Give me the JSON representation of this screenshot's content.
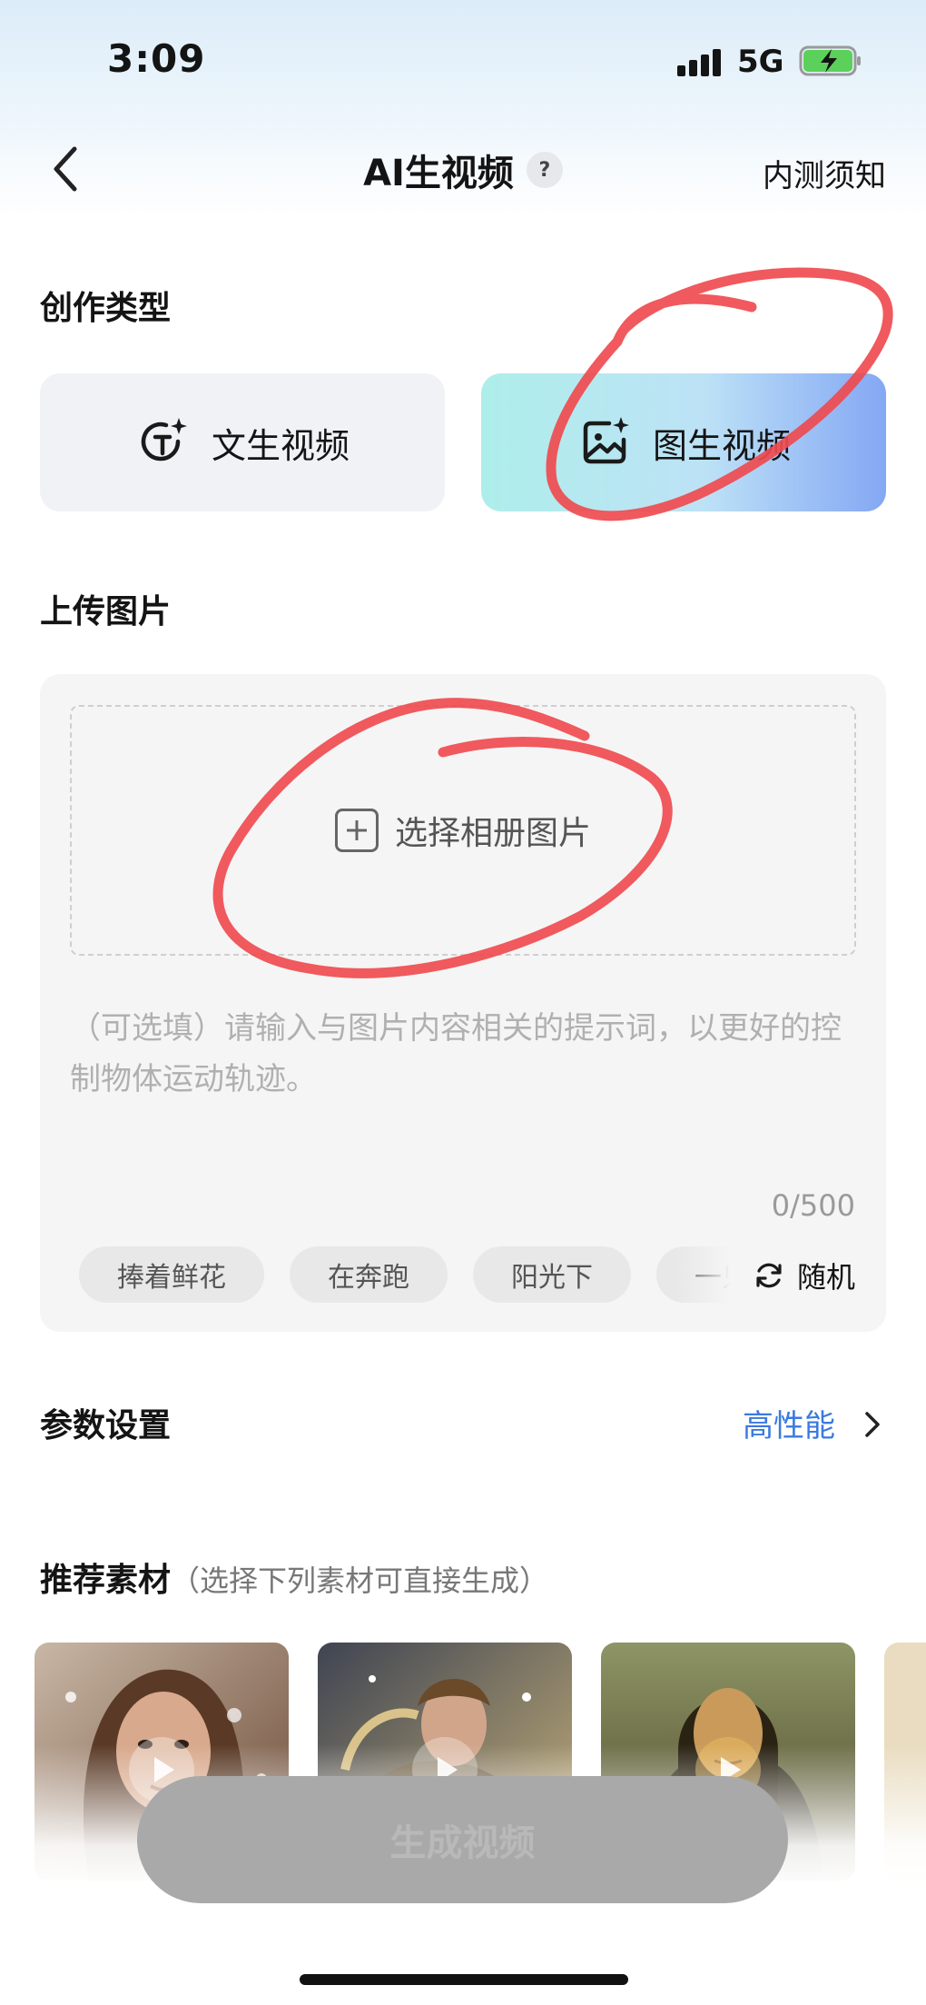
{
  "status_bar": {
    "time": "3:09",
    "network": "5G"
  },
  "nav": {
    "title": "AI生视频",
    "help_glyph": "?",
    "notice": "内测须知"
  },
  "creation_type": {
    "label": "创作类型",
    "options": [
      {
        "label": "文生视频",
        "icon": "text-spark-icon",
        "selected": false
      },
      {
        "label": "图生视频",
        "icon": "image-spark-icon",
        "selected": true
      }
    ]
  },
  "upload": {
    "label": "上传图片",
    "select_label": "选择相册图片",
    "prompt_placeholder": "（可选填）请输入与图片内容相关的提示词，以更好的控制物体运动轨迹。",
    "prompt_value": "",
    "counter": "0/500",
    "suggestions": [
      "捧着鲜花",
      "在奔跑",
      "阳光下",
      "一只"
    ],
    "random_label": "随机"
  },
  "params": {
    "label": "参数设置",
    "value": "高性能"
  },
  "recommend": {
    "title": "推荐素材",
    "subtitle": "（选择下列素材可直接生成）",
    "items": [
      "portrait-girl-thumbnail",
      "armored-knight-thumbnail",
      "mona-lisa-thumbnail",
      "partial-thumbnail"
    ]
  },
  "generate_label": "生成视频",
  "colors": {
    "accent_blue": "#3a7ae0",
    "annotation_red": "#ef4b4f",
    "button_disabled": "#a9a9a9"
  }
}
